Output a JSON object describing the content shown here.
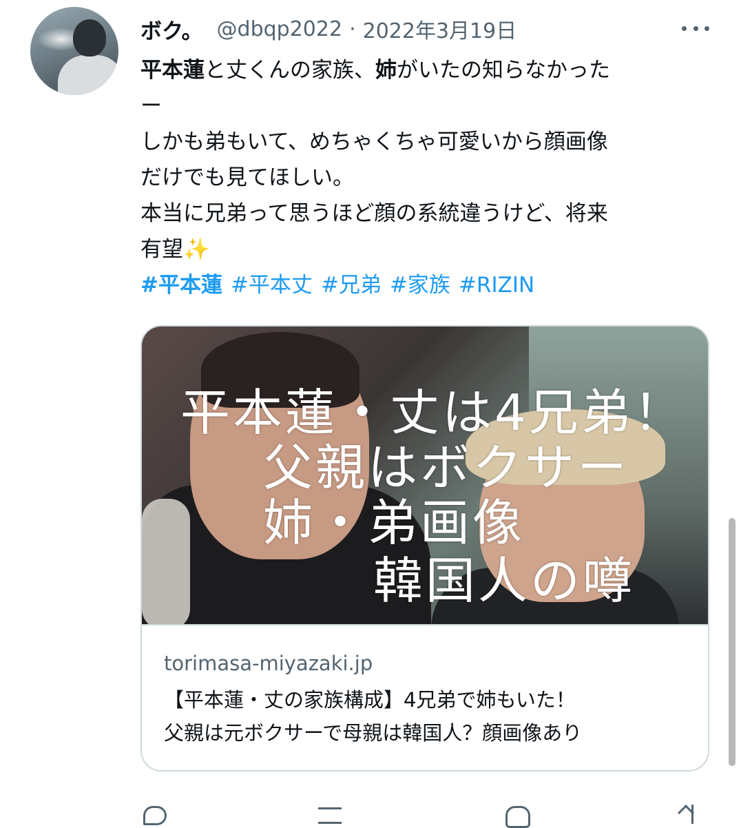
{
  "tweet": {
    "display_name": "ボク。",
    "handle": "@dbqp2022",
    "separator": "·",
    "date": "2022年3月19日",
    "text": {
      "l1_b1": "平本蓮",
      "l1_t1": "と丈くんの家族、",
      "l1_b2": "姉",
      "l1_t2": "がいたの知らなかった",
      "l2": "ー",
      "l3": "しかも弟もいて、めちゃくちゃ可愛いから顔画像",
      "l4": "だけでも見てほしい。",
      "l5": "本当に兄弟って思うほど顔の系統違うけど、将来",
      "l6": "有望",
      "sparkle": "✨"
    },
    "hashtags": [
      "#平本蓮",
      "#平本丈",
      "#兄弟",
      "#家族",
      "#RIZIN"
    ],
    "colors": {
      "link": "#1d9bf0",
      "secondary": "#536471",
      "border": "#cfd9de"
    }
  },
  "card": {
    "image_text": [
      "平本蓮・丈は4兄弟！",
      "父親はボクサー",
      "姉・弟画像",
      "韓国人の噂"
    ],
    "domain": "torimasa-miyazaki.jp",
    "title_lines": [
      "【平本蓮・丈の家族構成】4兄弟で姉もいた！",
      "父親は元ボクサーで母親は韓国人？顔画像あり"
    ]
  },
  "actions": {
    "icons": [
      "reply-icon",
      "retweet-icon",
      "like-icon",
      "share-icon"
    ]
  }
}
